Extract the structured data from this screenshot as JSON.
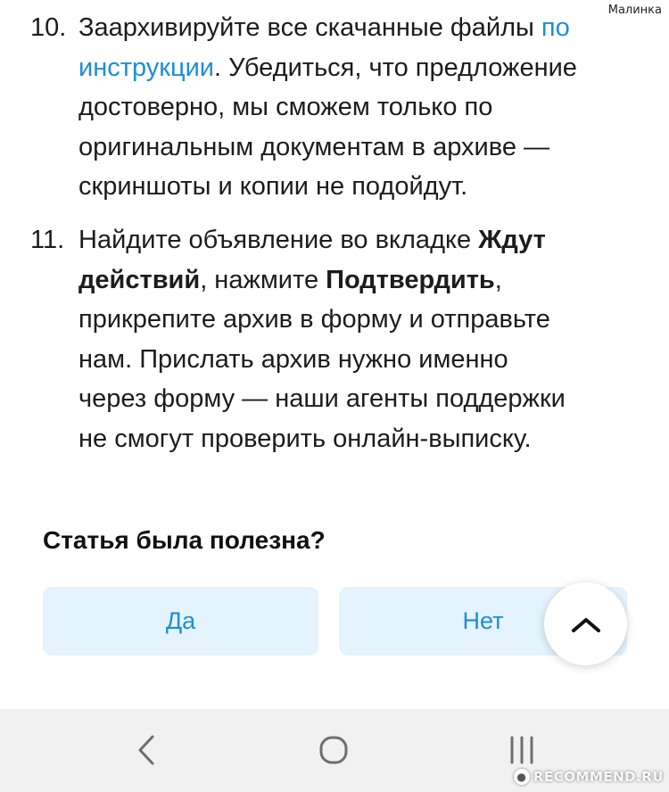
{
  "watermark_top": "Малинка",
  "steps": [
    {
      "number": "10.",
      "line1_before": "Заархивируйте все скачанные файлы ",
      "line1_link": "по",
      "line2_link": "инструкции",
      "line2_after": ". Убедиться, что предложение",
      "line3": "достоверно, мы сможем только по",
      "line4": "оригинальным документам в архиве —",
      "line5": "скриншоты и копии не подойдут."
    },
    {
      "number": "11.",
      "line1_before": "Найдите объявление во вкладке ",
      "line1_bold": "Ждут",
      "line2_bold": "действий",
      "line2_middle": ", нажмите ",
      "line2_bold2": "Подтвердить",
      "line2_after": ",",
      "line3": "прикрепите архив в форму и отправьте",
      "line4": "нам. Прислать архив нужно именно",
      "line5": "через форму — наши агенты поддержки",
      "line6": "не смогут проверить онлайн-выписку."
    }
  ],
  "feedback": {
    "question": "Статья была полезна?",
    "yes_label": "Да",
    "no_label": "Нет"
  },
  "icons": {
    "scroll_top": "chevron-up-icon",
    "nav_back": "chevron-left-icon",
    "nav_home": "home-icon",
    "nav_recents": "recents-icon"
  },
  "colors": {
    "link": "#1c8fd8",
    "button_bg": "#e4f3fd",
    "navbar_bg": "#f1f1f1"
  },
  "watermark_bottom": "RECOMMEND.RU"
}
